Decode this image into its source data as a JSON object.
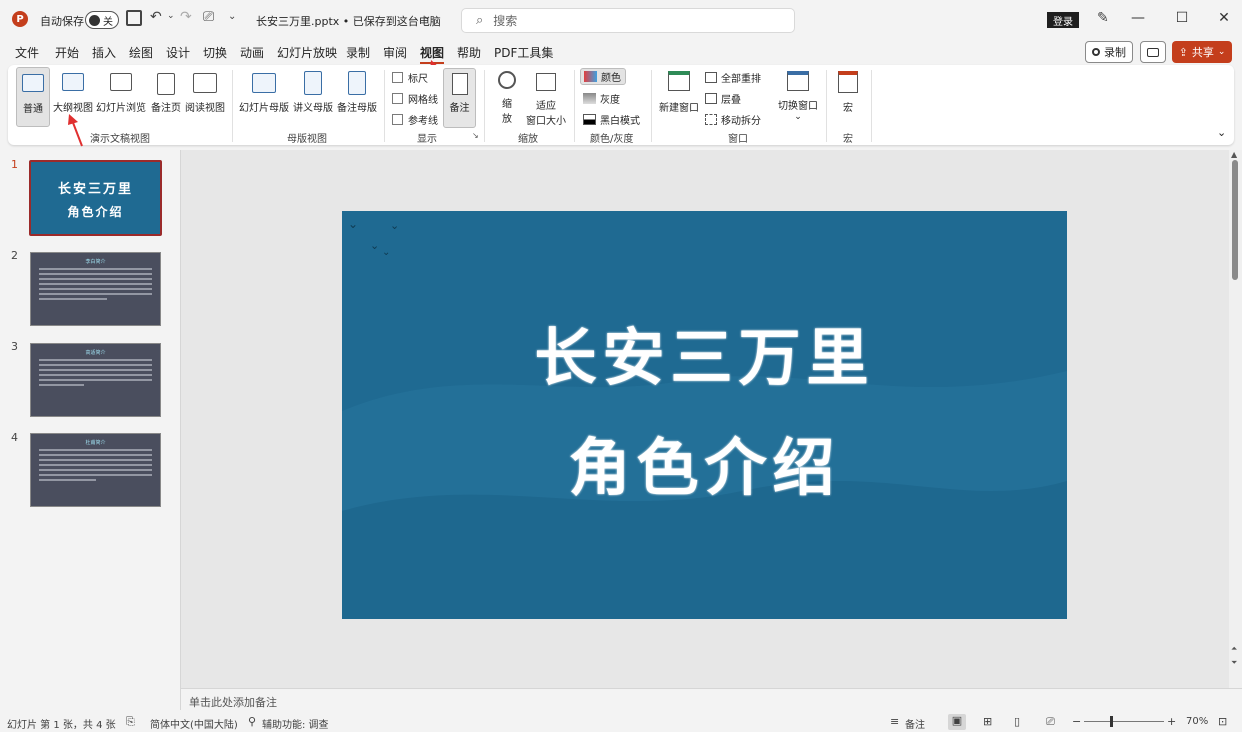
{
  "titlebar": {
    "autosave_label": "自动保存",
    "toggle_state": "关",
    "file_title": "长安三万里.pptx • 已保存到这台电脑",
    "search_placeholder": "搜索",
    "login_label": "登录"
  },
  "menu": {
    "items": [
      "文件",
      "开始",
      "插入",
      "绘图",
      "设计",
      "切换",
      "动画",
      "幻灯片放映",
      "录制",
      "审阅",
      "视图",
      "帮助",
      "PDF工具集"
    ],
    "active": "视图",
    "record_label": "录制",
    "share_label": "共享"
  },
  "ribbon": {
    "presentation_views": {
      "group_label": "演示文稿视图",
      "normal": "普通",
      "outline": "大纲视图",
      "slide_sorter": "幻灯片浏览",
      "notes_page": "备注页",
      "reading_view": "阅读视图"
    },
    "master_views": {
      "group_label": "母版视图",
      "slide_master": "幻灯片母版",
      "handout_master": "讲义母版",
      "notes_master": "备注母版"
    },
    "show": {
      "group_label": "显示",
      "ruler": "标尺",
      "gridlines": "网格线",
      "guides": "参考线",
      "notes": "备注"
    },
    "zoom": {
      "group_label": "缩放",
      "zoom_line1": "缩",
      "zoom_line2": "放",
      "fit_line1": "适应",
      "fit_line2": "窗口大小"
    },
    "color": {
      "group_label": "颜色/灰度",
      "color": "颜色",
      "grayscale": "灰度",
      "bw": "黑白模式"
    },
    "window": {
      "group_label": "窗口",
      "new_window": "新建窗口",
      "arrange_all": "全部重排",
      "cascade": "层叠",
      "move_split": "移动拆分",
      "switch_windows": "切换窗口"
    },
    "macros": {
      "group_label": "宏",
      "macro": "宏"
    }
  },
  "thumbnails": [
    {
      "number": "1",
      "line1": "长安三万里",
      "line2": "角色介绍"
    },
    {
      "number": "2",
      "heading": "李白简介"
    },
    {
      "number": "3",
      "heading": "高适简介"
    },
    {
      "number": "4",
      "heading": "杜甫简介"
    }
  ],
  "slide": {
    "title_line1": "长安三万里",
    "title_line2": "角色介绍"
  },
  "notes_placeholder": "单击此处添加备注",
  "status": {
    "slide_info": "幻灯片 第 1 张，共 4 张",
    "language": "简体中文(中国大陆)",
    "accessibility": "辅助功能: 调查",
    "notes_label": "备注",
    "zoom_level": "70%"
  },
  "colors": {
    "accent": "#c43e1c",
    "slide_bg": "#1f6a92",
    "thumb_bg": "#4a4e5e"
  }
}
